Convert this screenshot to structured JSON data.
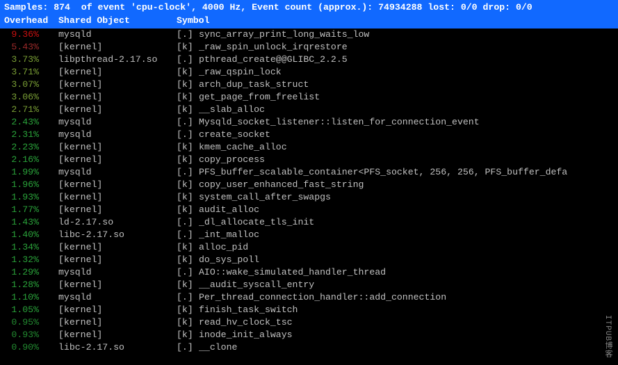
{
  "header": {
    "line1": "Samples: 874  of event 'cpu-clock', 4000 Hz, Event count (approx.): 74934288 lost: 0/0 drop: 0/0",
    "col_overhead": "Overhead",
    "col_object": "Shared Object",
    "col_symbol": "Symbol"
  },
  "rows": [
    {
      "overhead": "9.36%",
      "color": "c-red",
      "object": "mysqld",
      "kind": "[.]",
      "symbol": "sync_array_print_long_waits_low"
    },
    {
      "overhead": "5.43%",
      "color": "c-darkred",
      "object": "[kernel]",
      "kind": "[k]",
      "symbol": "_raw_spin_unlock_irqrestore"
    },
    {
      "overhead": "3.73%",
      "color": "c-olive",
      "object": "libpthread-2.17.so",
      "kind": "[.]",
      "symbol": "pthread_create@@GLIBC_2.2.5"
    },
    {
      "overhead": "3.71%",
      "color": "c-olive",
      "object": "[kernel]",
      "kind": "[k]",
      "symbol": "_raw_qspin_lock"
    },
    {
      "overhead": "3.07%",
      "color": "c-olive",
      "object": "[kernel]",
      "kind": "[k]",
      "symbol": "arch_dup_task_struct"
    },
    {
      "overhead": "3.06%",
      "color": "c-olive",
      "object": "[kernel]",
      "kind": "[k]",
      "symbol": "get_page_from_freelist"
    },
    {
      "overhead": "2.71%",
      "color": "c-olive",
      "object": "[kernel]",
      "kind": "[k]",
      "symbol": "__slab_alloc"
    },
    {
      "overhead": "2.43%",
      "color": "c-green",
      "object": "mysqld",
      "kind": "[.]",
      "symbol": "Mysqld_socket_listener::listen_for_connection_event"
    },
    {
      "overhead": "2.31%",
      "color": "c-green",
      "object": "mysqld",
      "kind": "[.]",
      "symbol": "create_socket"
    },
    {
      "overhead": "2.23%",
      "color": "c-green",
      "object": "[kernel]",
      "kind": "[k]",
      "symbol": "kmem_cache_alloc"
    },
    {
      "overhead": "2.16%",
      "color": "c-green",
      "object": "[kernel]",
      "kind": "[k]",
      "symbol": "copy_process"
    },
    {
      "overhead": "1.99%",
      "color": "c-green",
      "object": "mysqld",
      "kind": "[.]",
      "symbol": "PFS_buffer_scalable_container<PFS_socket, 256, 256, PFS_buffer_defa"
    },
    {
      "overhead": "1.96%",
      "color": "c-green",
      "object": "[kernel]",
      "kind": "[k]",
      "symbol": "copy_user_enhanced_fast_string"
    },
    {
      "overhead": "1.93%",
      "color": "c-green",
      "object": "[kernel]",
      "kind": "[k]",
      "symbol": "system_call_after_swapgs"
    },
    {
      "overhead": "1.77%",
      "color": "c-green",
      "object": "[kernel]",
      "kind": "[k]",
      "symbol": "audit_alloc"
    },
    {
      "overhead": "1.43%",
      "color": "c-green",
      "object": "ld-2.17.so",
      "kind": "[.]",
      "symbol": "_dl_allocate_tls_init"
    },
    {
      "overhead": "1.40%",
      "color": "c-green",
      "object": "libc-2.17.so",
      "kind": "[.]",
      "symbol": "_int_malloc"
    },
    {
      "overhead": "1.34%",
      "color": "c-green",
      "object": "[kernel]",
      "kind": "[k]",
      "symbol": "alloc_pid"
    },
    {
      "overhead": "1.32%",
      "color": "c-green",
      "object": "[kernel]",
      "kind": "[k]",
      "symbol": "do_sys_poll"
    },
    {
      "overhead": "1.29%",
      "color": "c-green",
      "object": "mysqld",
      "kind": "[.]",
      "symbol": "AIO::wake_simulated_handler_thread"
    },
    {
      "overhead": "1.28%",
      "color": "c-green",
      "object": "[kernel]",
      "kind": "[k]",
      "symbol": "__audit_syscall_entry"
    },
    {
      "overhead": "1.10%",
      "color": "c-green",
      "object": "mysqld",
      "kind": "[.]",
      "symbol": "Per_thread_connection_handler::add_connection"
    },
    {
      "overhead": "1.05%",
      "color": "c-green",
      "object": "[kernel]",
      "kind": "[k]",
      "symbol": "finish_task_switch"
    },
    {
      "overhead": "0.95%",
      "color": "c-dgreen",
      "object": "[kernel]",
      "kind": "[k]",
      "symbol": "read_hv_clock_tsc"
    },
    {
      "overhead": "0.93%",
      "color": "c-dgreen",
      "object": "[kernel]",
      "kind": "[k]",
      "symbol": "inode_init_always"
    },
    {
      "overhead": "0.90%",
      "color": "c-dgreen",
      "object": "libc-2.17.so",
      "kind": "[.]",
      "symbol": "__clone"
    }
  ],
  "watermark": "ITPUB博客"
}
